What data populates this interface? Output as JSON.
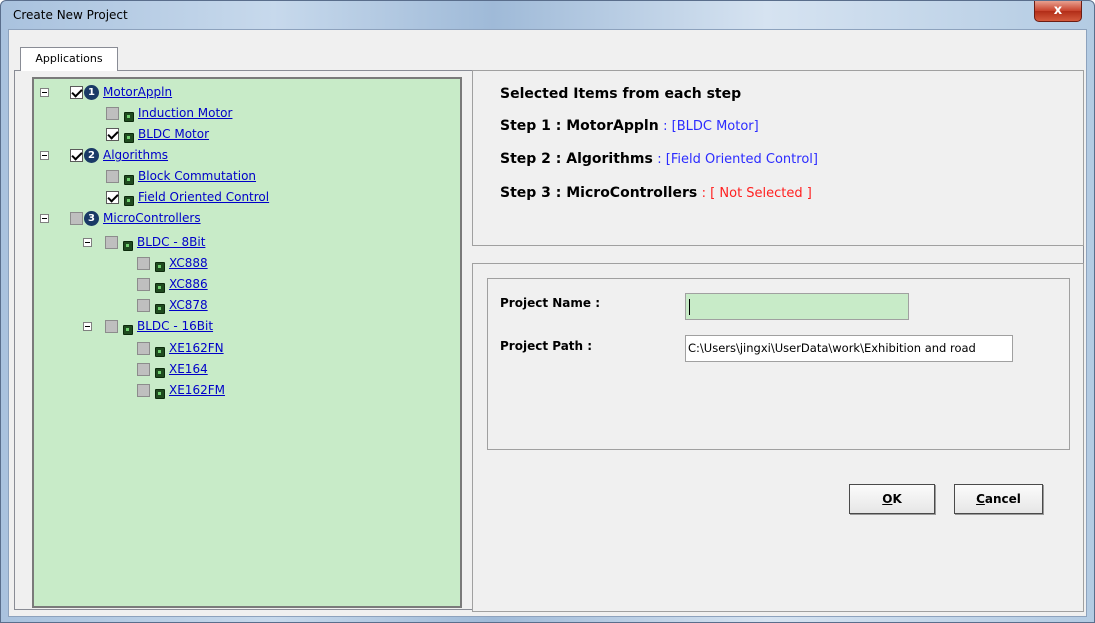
{
  "window": {
    "title": "Create New Project",
    "close_glyph": "x"
  },
  "tabs": [
    {
      "label": "Applications"
    }
  ],
  "tree": {
    "motorappln": {
      "num": "1",
      "label": "MotorAppln"
    },
    "induction_motor": {
      "label": "Induction Motor"
    },
    "bldc_motor": {
      "label": "BLDC Motor"
    },
    "algorithms": {
      "num": "2",
      "label": "Algorithms"
    },
    "block_commutation": {
      "label": "Block Commutation"
    },
    "foc": {
      "label": "Field Oriented Control"
    },
    "microcontrollers": {
      "num": "3",
      "label": "MicroControllers"
    },
    "bldc8": {
      "label": "BLDC - 8Bit"
    },
    "xc888": {
      "label": "XC888"
    },
    "xc886": {
      "label": "XC886"
    },
    "xc878": {
      "label": "XC878"
    },
    "bldc16": {
      "label": "BLDC - 16Bit"
    },
    "xe162fn": {
      "label": "XE162FN"
    },
    "xe164": {
      "label": "XE164"
    },
    "xe162fm": {
      "label": "XE162FM"
    }
  },
  "summary": {
    "heading": "Selected Items from each step",
    "steps": [
      {
        "key": "Step 1 : MotorAppln",
        "value": ": [BLDC Motor]"
      },
      {
        "key": "Step 2 : Algorithms",
        "value": ": [Field Oriented Control]"
      },
      {
        "key": "Step 3 : MicroControllers",
        "value": ": [ Not Selected ]"
      }
    ]
  },
  "form": {
    "project_name_label": "Project Name :",
    "project_name_value": "",
    "project_path_label": "Project Path :",
    "project_path_value": "C:\\Users\\jingxi\\UserData\\work\\Exhibition and road"
  },
  "buttons": {
    "ok_mnemonic": "O",
    "ok_rest": "K",
    "cancel_mnemonic": "C",
    "cancel_rest": "ancel"
  },
  "colors": {
    "tree_bg": "#c8ebc8",
    "link_blue": "#0000c8",
    "value_blue": "#2b2bff",
    "value_red": "#ff2020"
  }
}
